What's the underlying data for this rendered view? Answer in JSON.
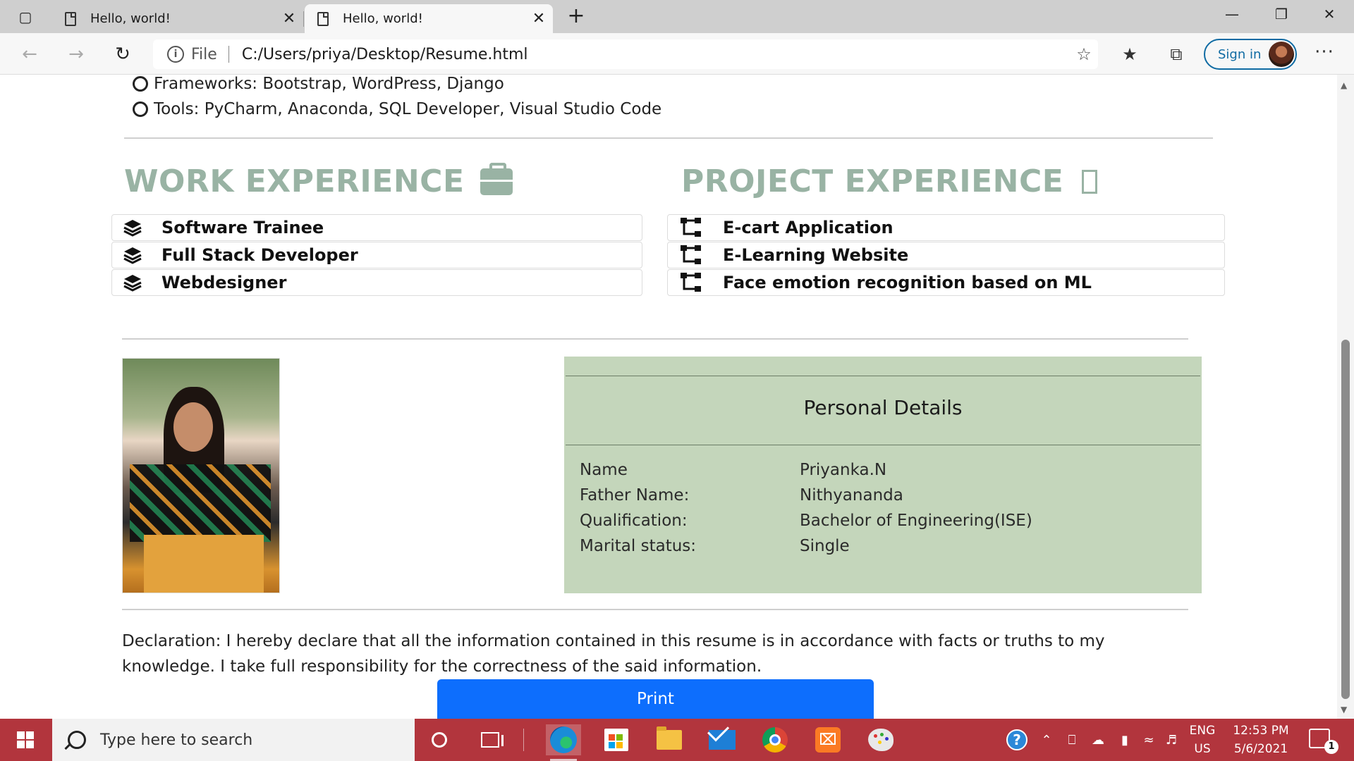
{
  "browser": {
    "tabs": [
      {
        "title": "Hello, world!"
      },
      {
        "title": "Hello, world!"
      }
    ],
    "address": {
      "scheme_label": "File",
      "url": "C:/Users/priya/Desktop/Resume.html"
    },
    "sign_in_label": "Sign in"
  },
  "resume": {
    "skills": [
      "Frameworks: Bootstrap, WordPress, Django",
      "Tools: PyCharm, Anaconda, SQL Developer, Visual Studio Code"
    ],
    "work_title": "WORK EXPERIENCE",
    "work_items": [
      "Software Trainee",
      "Full Stack Developer",
      "Webdesigner"
    ],
    "project_title": "PROJECT EXPERIENCE",
    "project_items": [
      "E-cart Application",
      "E-Learning Website",
      "Face emotion recognition based on ML"
    ],
    "personal": {
      "title": "Personal Details",
      "rows": [
        {
          "label": "Name",
          "value": "Priyanka.N"
        },
        {
          "label": "Father Name:",
          "value": "Nithyananda"
        },
        {
          "label": "Qualification:",
          "value": "Bachelor of Engineering(ISE)"
        },
        {
          "label": "Marital status:",
          "value": "Single"
        }
      ]
    },
    "declaration": "Declaration: I hereby declare that all the information contained in this resume is in accordance with facts or truths to my knowledge. I take full responsibility for the correctness of the said information.",
    "print_label": "Print"
  },
  "colors": {
    "section_title": "#99b3a4",
    "details_bg": "#c4d6bb",
    "print_button": "#0d6efd",
    "taskbar": "#b2353d"
  },
  "taskbar": {
    "search_placeholder": "Type here to search",
    "lang_line1": "ENG",
    "lang_line2": "US",
    "time": "12:53 PM",
    "date": "5/6/2021",
    "notification_count": "1"
  }
}
